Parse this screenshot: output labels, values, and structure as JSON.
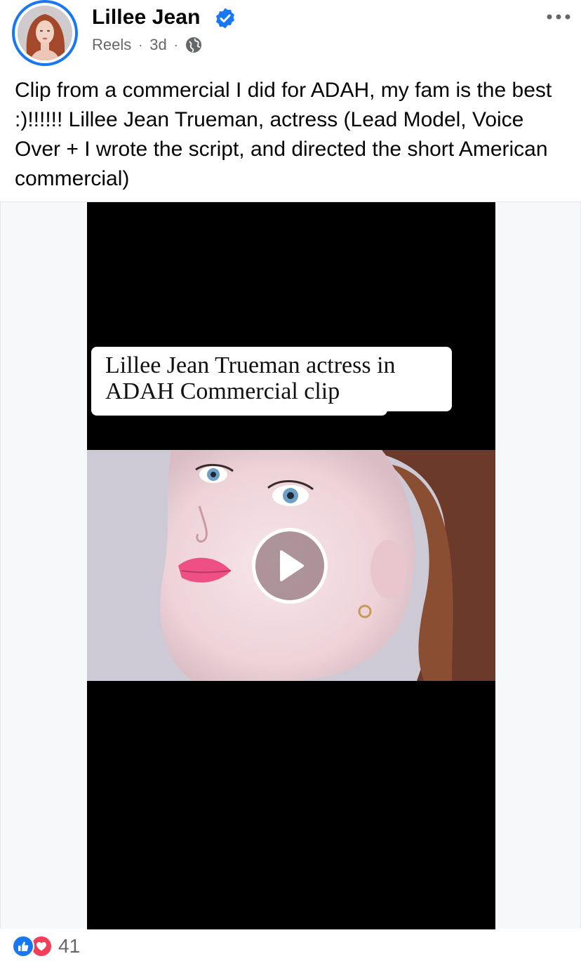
{
  "post": {
    "author_name": "Lillee Jean",
    "verified": true,
    "meta_type": "Reels",
    "meta_dot": "·",
    "meta_time": "3d",
    "privacy_icon": "globe-icon",
    "more_icon": "more-horizontal-icon",
    "caption": "Clip from a commercial I did for ADAH, my fam is the best :)!!!!!! Lillee Jean Trueman, actress (Lead Model, Voice Over + I wrote the script, and directed the short American commercial)"
  },
  "video": {
    "overlay_text": "Lillee Jean Trueman actress in ADAH Commercial clip",
    "play_icon": "play-icon"
  },
  "reactions": {
    "icons": [
      "like-icon",
      "love-icon"
    ],
    "count": "41"
  },
  "colors": {
    "brand_blue": "#1877f2",
    "love_red": "#f33e58",
    "meta_gray": "#65676b",
    "text": "#050505"
  }
}
